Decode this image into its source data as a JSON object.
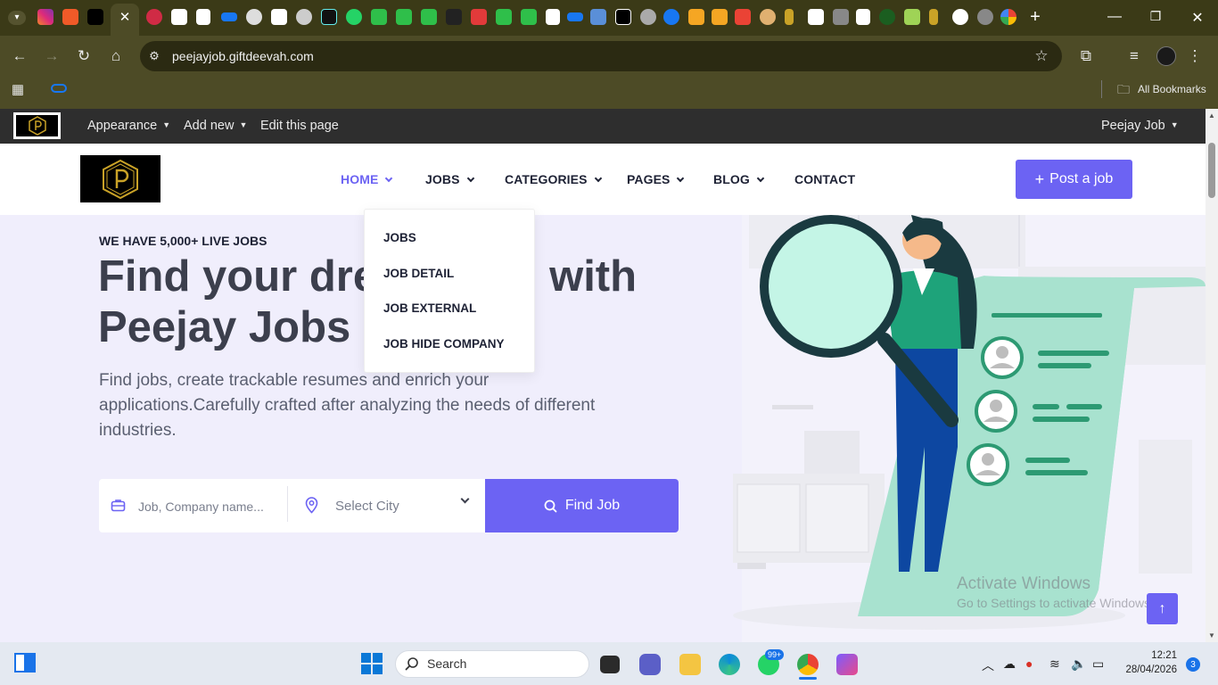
{
  "browser": {
    "url": "peejayjob.giftdeevah.com",
    "bookmarks_label": "All Bookmarks"
  },
  "admin_bar": {
    "appearance": "Appearance",
    "add_new": "Add new",
    "edit_page": "Edit this page",
    "user": "Peejay Job"
  },
  "nav": {
    "home": "HOME",
    "jobs": "JOBS",
    "categories": "CATEGORIES",
    "pages": "PAGES",
    "blog": "BLOG",
    "contact": "CONTACT",
    "post_job": "Post a job"
  },
  "dropdown": {
    "items": [
      "JOBS",
      "JOB DETAIL",
      "JOB EXTERNAL",
      "JOB HIDE COMPANY"
    ]
  },
  "hero": {
    "eyebrow": "WE HAVE 5,000+ LIVE JOBS",
    "headline_line1": "Find your dre",
    "headline_with": "with",
    "headline_line2": "Peejay Jobs",
    "lead": "Find jobs, create trackable resumes and enrich your applications.Carefully crafted after analyzing the needs of different industries."
  },
  "search": {
    "keyword_placeholder": "Job, Company name...",
    "city_placeholder": "Select City",
    "button_label": "Find Job"
  },
  "watermark": {
    "line1": "Activate Windows",
    "line2": "Go to Settings to activate Windows."
  },
  "taskbar": {
    "search_label": "Search",
    "badge_whatsapp": "99+",
    "time": "12:21",
    "date": "28/04/2026",
    "notifications": "3"
  },
  "colors": {
    "accent": "#6c63f3",
    "hero_bg": "#f0eefc",
    "admin_bar": "#2e2e2e",
    "browser_frame": "#4d4b26"
  }
}
